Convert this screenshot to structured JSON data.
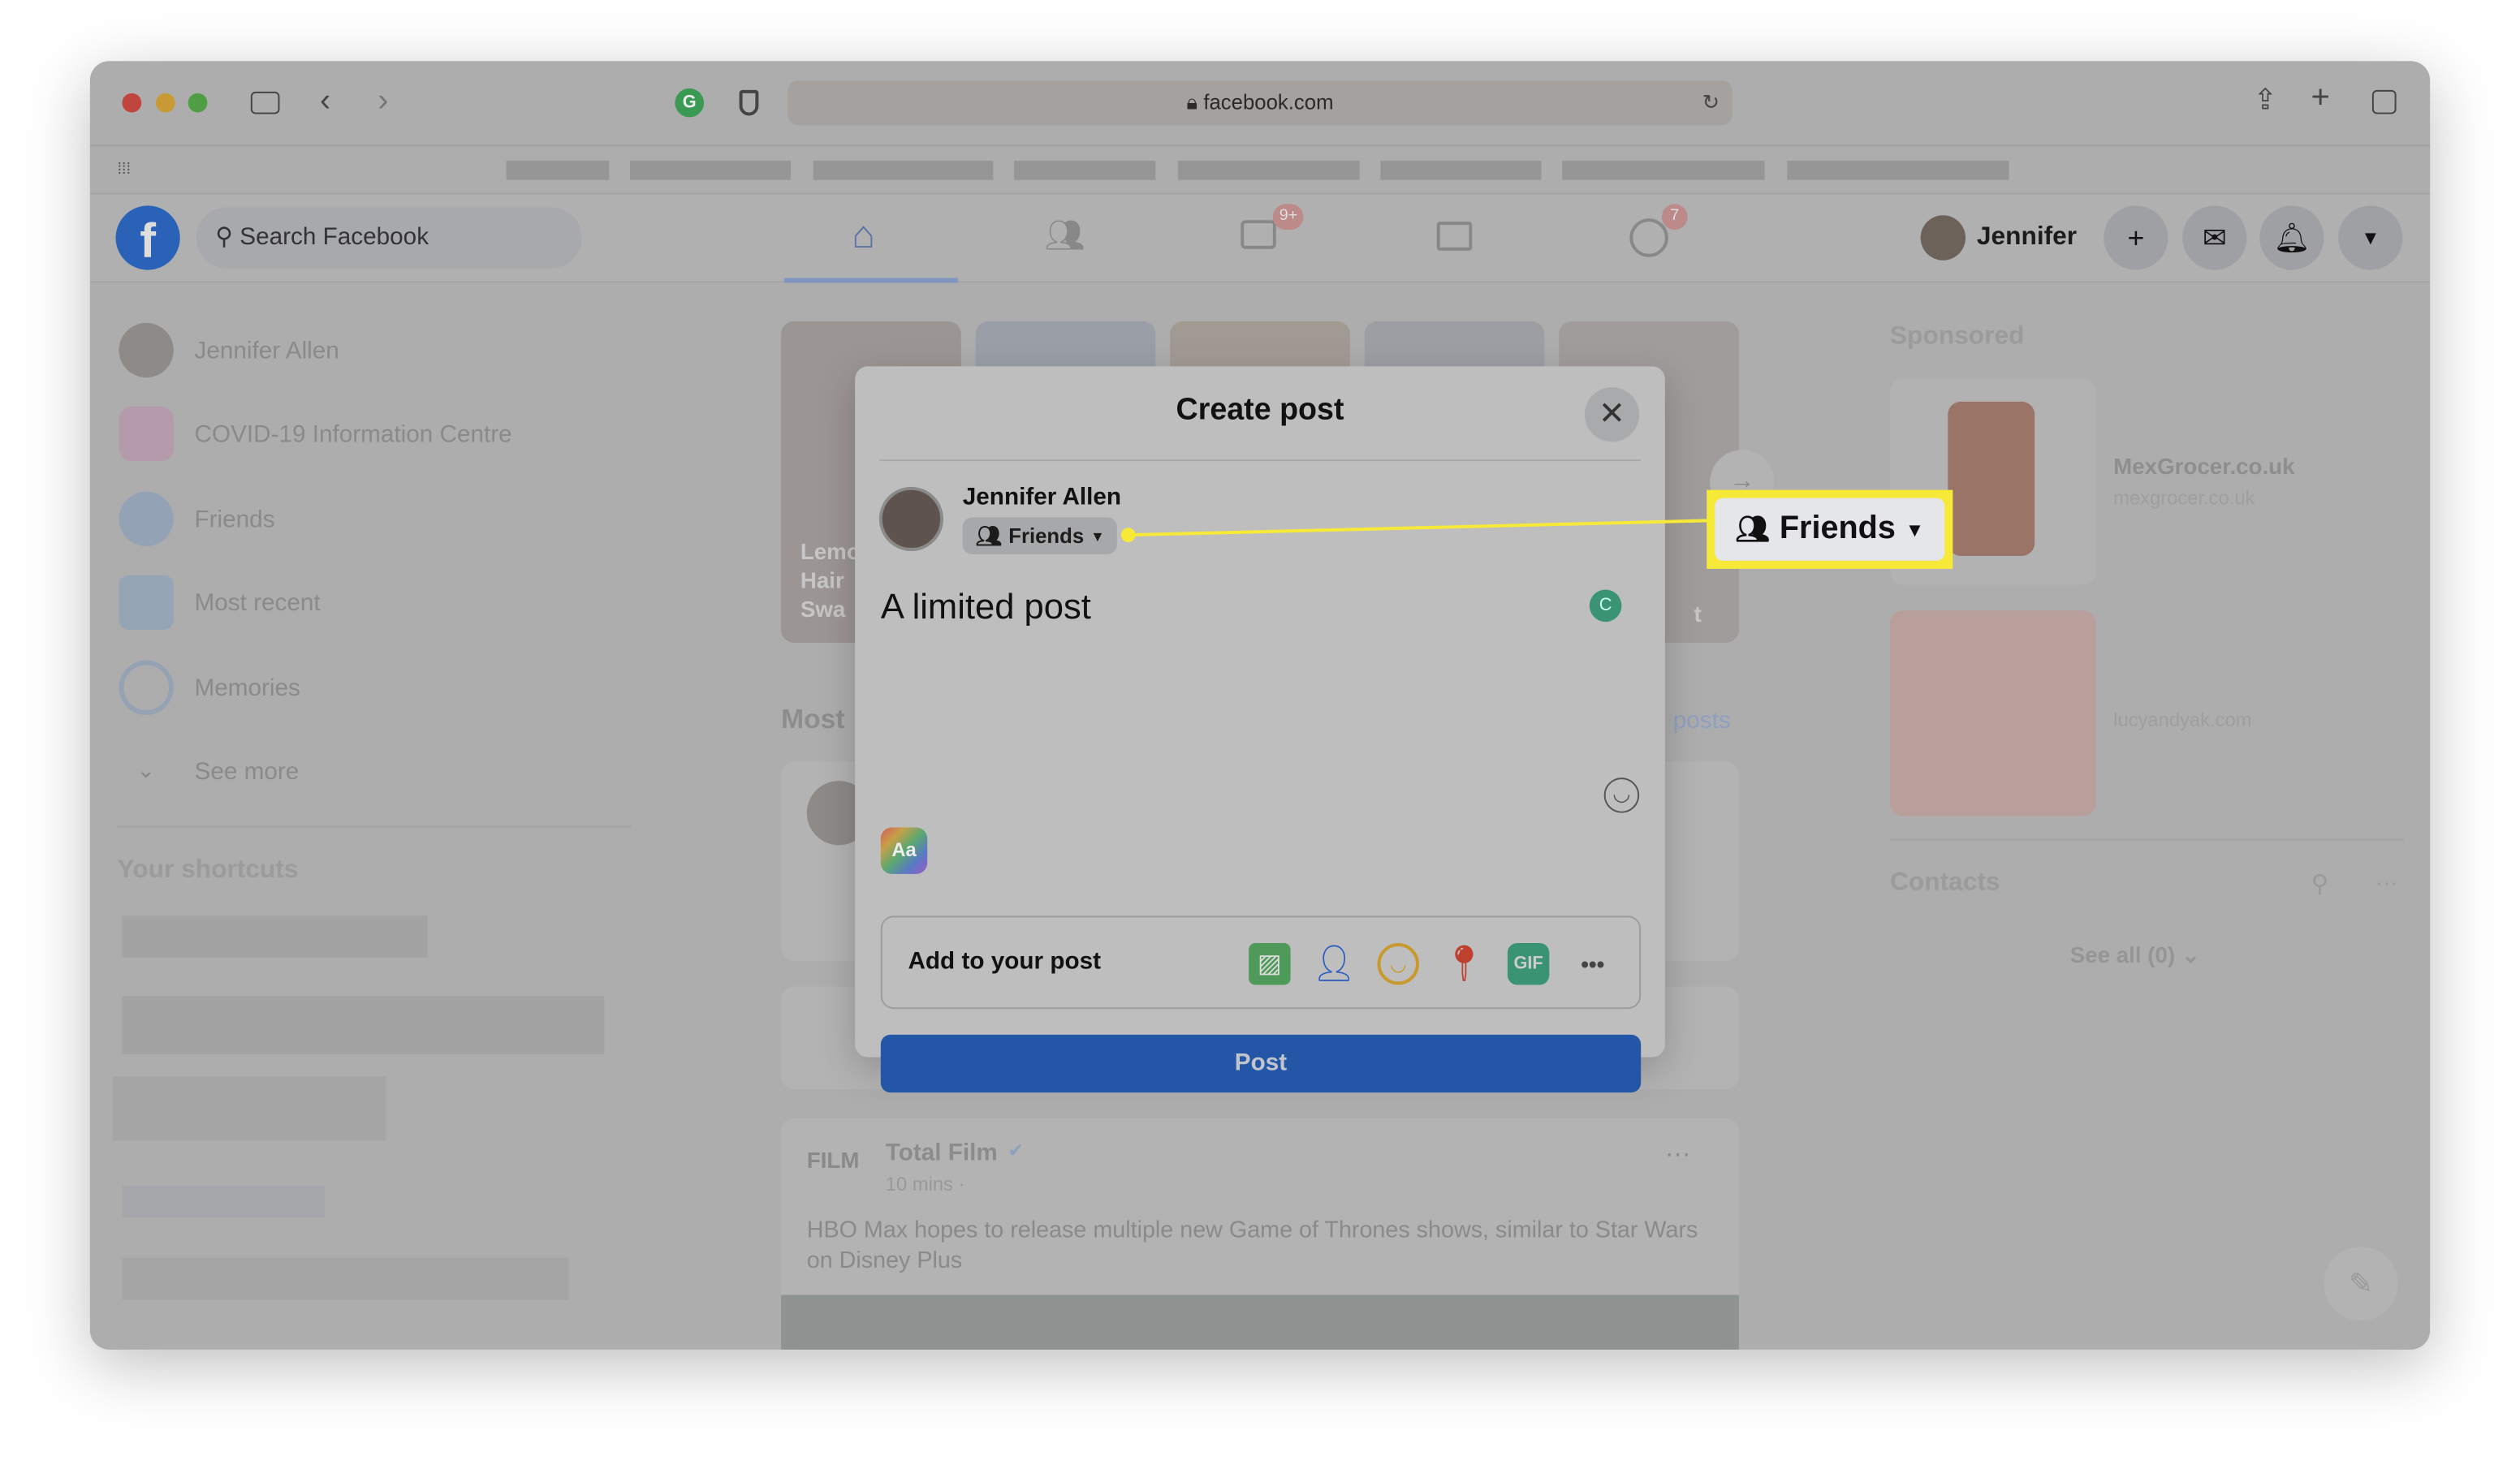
{
  "browser": {
    "url": "facebook.com"
  },
  "header": {
    "search_placeholder": "Search Facebook",
    "user_name": "Jennifer",
    "watch_badge": "9+",
    "groups_badge": "7"
  },
  "sidebar": {
    "items": [
      {
        "label": "Jennifer Allen",
        "icon": "avatar"
      },
      {
        "label": "COVID-19 Information Centre",
        "icon": "shield-heart-icon"
      },
      {
        "label": "Friends",
        "icon": "friends-icon"
      },
      {
        "label": "Most recent",
        "icon": "clock-calendar-icon"
      },
      {
        "label": "Memories",
        "icon": "history-icon"
      },
      {
        "label": "See more",
        "icon": "chevron-down-icon"
      }
    ],
    "shortcuts_title": "Your shortcuts"
  },
  "stories": {
    "first_label": "Lemo Hair Swa",
    "last_label": "t"
  },
  "feed": {
    "section_label": "Most",
    "section_link": "posts",
    "post": {
      "author": "Total Film",
      "time": "10 mins ·",
      "logo": "FILM",
      "text": "HBO Max hopes to release multiple new Game of Thrones shows, similar to Star Wars on Disney Plus"
    }
  },
  "right": {
    "sponsored_title": "Sponsored",
    "ads": [
      {
        "name": "MexGrocer.co.uk",
        "domain": "mexgrocer.co.uk"
      },
      {
        "name": "",
        "domain": "lucyandyak.com"
      }
    ],
    "contacts_title": "Contacts",
    "see_all": "See all (0)"
  },
  "modal": {
    "title": "Create post",
    "author": "Jennifer Allen",
    "audience": "Friends",
    "text": "A limited post",
    "text_style_label": "Aa",
    "add_to_post": "Add to your post",
    "post_button": "Post",
    "actions": [
      "photo-video",
      "tag-people",
      "feeling",
      "check-in",
      "gif",
      "more"
    ],
    "gif_label": "GIF"
  },
  "callout": {
    "label": "Friends",
    "color": "#f7e937"
  },
  "colors": {
    "post_button": "#2456a8",
    "highlight": "#f7e937"
  }
}
